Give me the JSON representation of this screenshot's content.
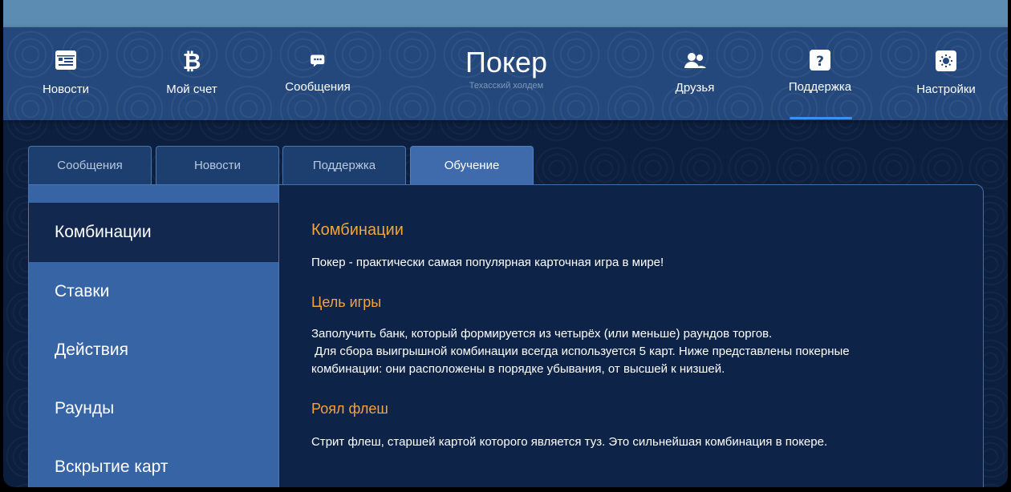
{
  "nav": {
    "items": [
      {
        "label": "Новости",
        "icon": "newspaper-icon"
      },
      {
        "label": "Мой счет",
        "icon": "bitcoin-icon"
      },
      {
        "label": "Сообщения",
        "icon": "chat-bubble-icon"
      },
      {
        "label": "Друзья",
        "icon": "friends-icon"
      },
      {
        "label": "Поддержка",
        "icon": "help-icon"
      },
      {
        "label": "Настройки",
        "icon": "settings-icon"
      }
    ],
    "active": "Поддержка"
  },
  "brand": {
    "title": "Покер",
    "subtitle": "Техасский холдем"
  },
  "tabs": [
    {
      "label": "Сообщения"
    },
    {
      "label": "Новости"
    },
    {
      "label": "Поддержка"
    },
    {
      "label": "Обучение"
    }
  ],
  "active_tab": "Обучение",
  "sidebar": {
    "items": [
      {
        "label": "Комбинации"
      },
      {
        "label": "Ставки"
      },
      {
        "label": "Действия"
      },
      {
        "label": "Раунды"
      },
      {
        "label": "Вскрытие карт"
      }
    ],
    "active": "Комбинации"
  },
  "content": {
    "title": "Комбинации",
    "intro": "Покер - практически самая популярная карточная игра в мире!",
    "goal_heading": "Цель игры",
    "goal_line1": "Заполучить банк, который формируется из четырёх (или меньше) раундов торгов.",
    "goal_line2": " Для сбора выигрышной комбинации всегда используется 5 карт. Ниже представлены покерные",
    "goal_line3": "комбинации: они расположены в порядке убывания, от высшей к низшей.",
    "royal_heading": "Роял флеш",
    "royal_text": "Стрит флеш, старшей картой которого является туз. Это сильнейшая комбинация в покере."
  },
  "colors": {
    "accent_orange": "#f5a33b",
    "nav_underline": "#3d8ef0",
    "panel_dark": "#0e2348",
    "panel_blue": "#3764a5"
  }
}
